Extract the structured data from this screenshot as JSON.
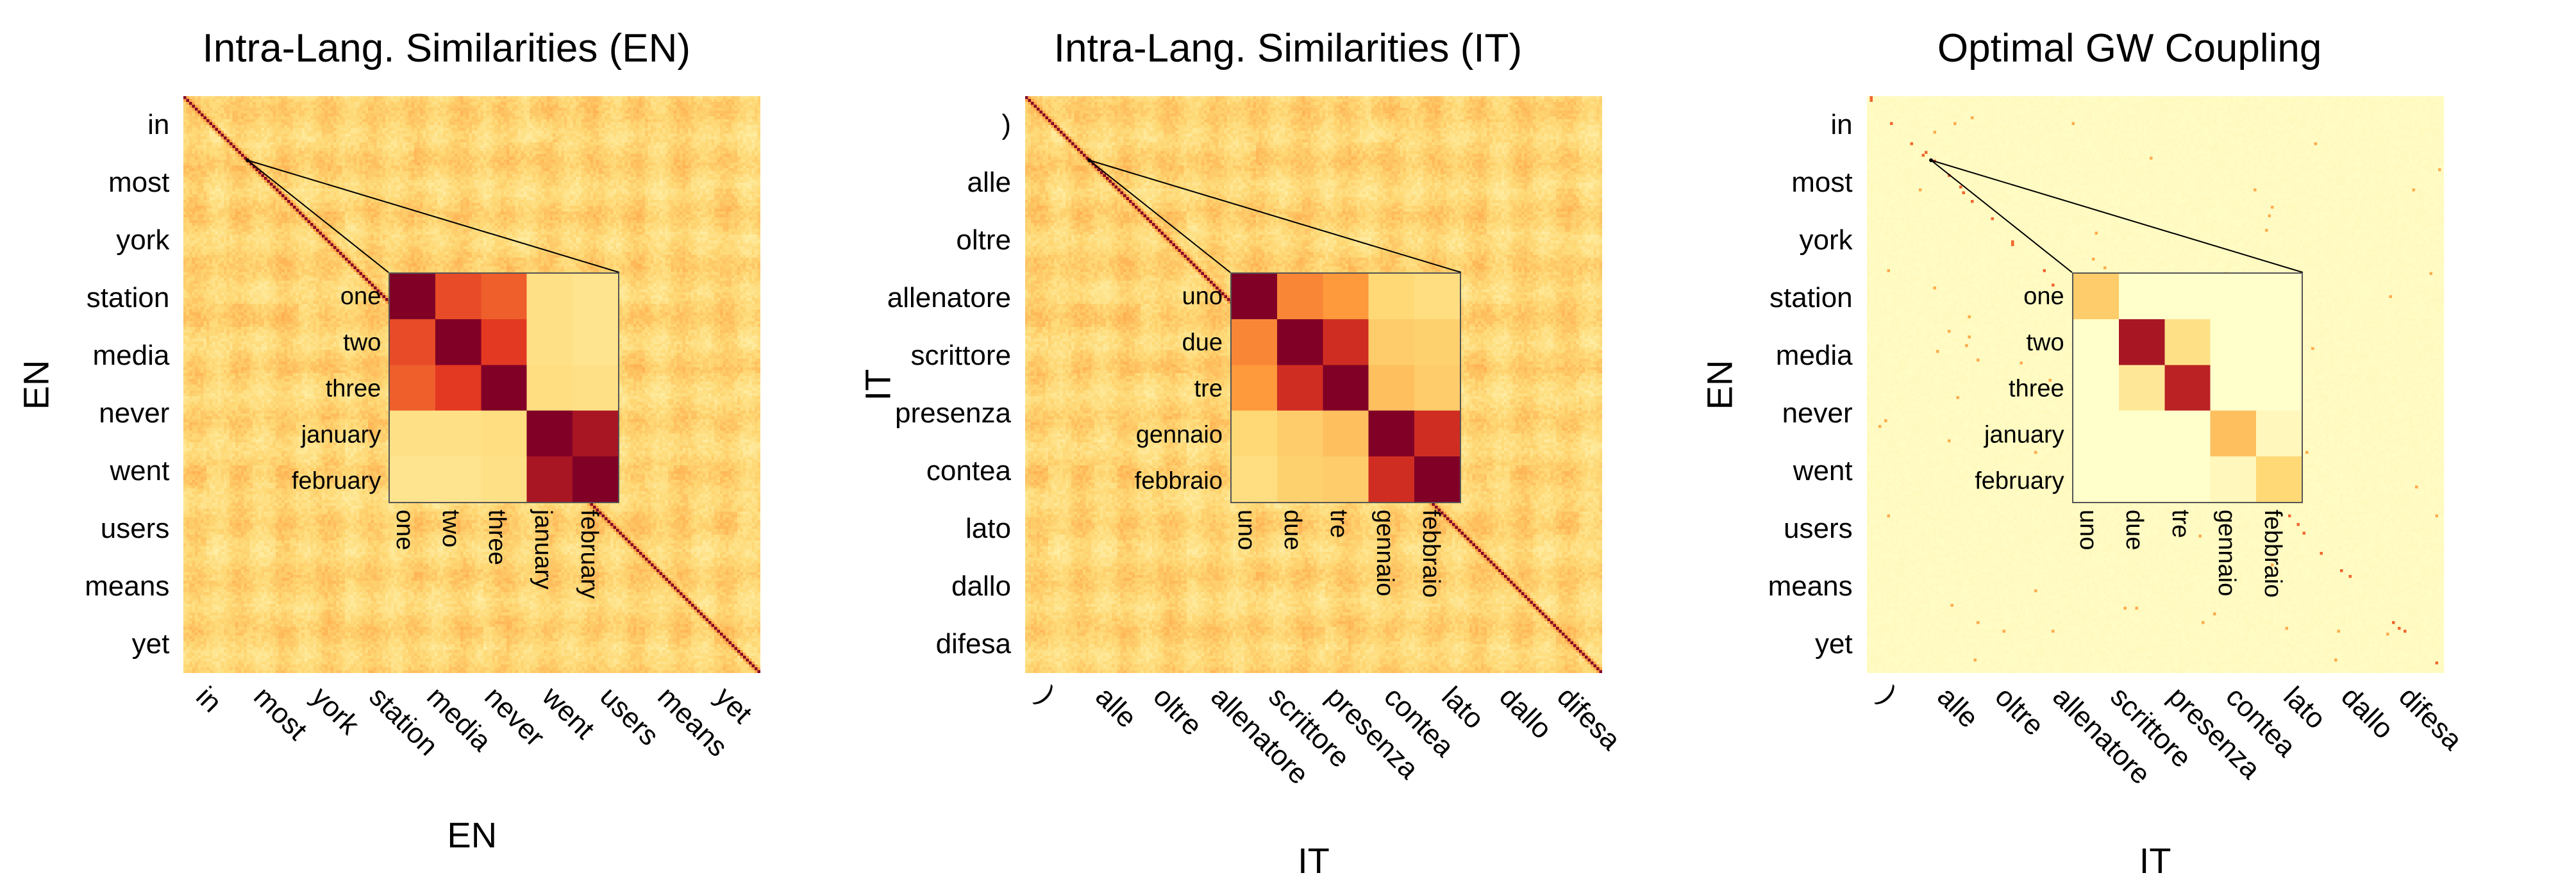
{
  "chart_data": [
    {
      "id": "en",
      "type": "heatmap",
      "title": "Intra-Lang. Similarities (EN)",
      "xlabel": "EN",
      "ylabel": "EN",
      "x_ticks": [
        "in",
        "most",
        "york",
        "station",
        "media",
        "never",
        "went",
        "users",
        "means",
        "yet"
      ],
      "y_ticks": [
        "in",
        "most",
        "york",
        "station",
        "media",
        "never",
        "went",
        "users",
        "means",
        "yet"
      ],
      "xlim": [
        0,
        1000
      ],
      "ylim": [
        0,
        1000
      ],
      "note": "1000x1000 cosine-similarity matrix; mostly low (pale yellow), diagonal high (dark red).",
      "inset": {
        "type": "heatmap",
        "row_labels": [
          "one",
          "two",
          "three",
          "january",
          "february"
        ],
        "col_labels": [
          "one",
          "two",
          "three",
          "january",
          "february"
        ],
        "values": [
          [
            1.0,
            0.7,
            0.65,
            0.2,
            0.18
          ],
          [
            0.7,
            1.0,
            0.75,
            0.2,
            0.18
          ],
          [
            0.65,
            0.75,
            1.0,
            0.22,
            0.2
          ],
          [
            0.2,
            0.2,
            0.22,
            1.0,
            0.9
          ],
          [
            0.18,
            0.18,
            0.2,
            0.9,
            1.0
          ]
        ],
        "colorscale": "YlOrRd",
        "vmin": 0.0,
        "vmax": 1.0
      }
    },
    {
      "id": "it",
      "type": "heatmap",
      "title": "Intra-Lang. Similarities (IT)",
      "xlabel": "IT",
      "ylabel": "IT",
      "x_ticks": [
        ")",
        "alle",
        "oltre",
        "allenatore",
        "scrittore",
        "presenza",
        "contea",
        "lato",
        "dallo",
        "difesa"
      ],
      "y_ticks": [
        ")",
        "alle",
        "oltre",
        "allenatore",
        "scrittore",
        "presenza",
        "contea",
        "lato",
        "dallo",
        "difesa"
      ],
      "xlim": [
        0,
        1000
      ],
      "ylim": [
        0,
        1000
      ],
      "note": "1000x1000 cosine-similarity matrix; mostly low (pale yellow), diagonal high (dark red).",
      "inset": {
        "type": "heatmap",
        "row_labels": [
          "uno",
          "due",
          "tre",
          "gennaio",
          "febbraio"
        ],
        "col_labels": [
          "uno",
          "due",
          "tre",
          "gennaio",
          "febbraio"
        ],
        "values": [
          [
            1.0,
            0.55,
            0.5,
            0.25,
            0.22
          ],
          [
            0.55,
            1.0,
            0.8,
            0.3,
            0.28
          ],
          [
            0.5,
            0.8,
            1.0,
            0.35,
            0.3
          ],
          [
            0.25,
            0.3,
            0.35,
            1.0,
            0.8
          ],
          [
            0.22,
            0.28,
            0.3,
            0.8,
            1.0
          ]
        ],
        "colorscale": "YlOrRd",
        "vmin": 0.0,
        "vmax": 1.0
      }
    },
    {
      "id": "gw",
      "type": "heatmap",
      "title": "Optimal GW Coupling",
      "xlabel": "IT",
      "ylabel": "EN",
      "x_ticks": [
        ")",
        "alle",
        "oltre",
        "allenatore",
        "scrittore",
        "presenza",
        "contea",
        "lato",
        "dallo",
        "difesa"
      ],
      "y_ticks": [
        "in",
        "most",
        "york",
        "station",
        "media",
        "never",
        "went",
        "users",
        "means",
        "yet"
      ],
      "xlim": [
        0,
        1000
      ],
      "ylim": [
        0,
        1000
      ],
      "note": "Sparse coupling matrix; near-zero everywhere (very pale), tiny dark points near diagonal.",
      "inset": {
        "type": "heatmap",
        "row_labels": [
          "one",
          "two",
          "three",
          "january",
          "february"
        ],
        "col_labels": [
          "uno",
          "due",
          "tre",
          "gennaio",
          "febbraio"
        ],
        "values": [
          [
            0.3,
            0.0,
            0.0,
            0.0,
            0.0
          ],
          [
            0.0,
            0.9,
            0.2,
            0.0,
            0.0
          ],
          [
            0.0,
            0.15,
            0.85,
            0.0,
            0.0
          ],
          [
            0.0,
            0.0,
            0.0,
            0.35,
            0.05
          ],
          [
            0.0,
            0.0,
            0.0,
            0.05,
            0.25
          ]
        ],
        "colorscale": "YlOrRd",
        "vmin": 0.0,
        "vmax": 1.0
      }
    }
  ],
  "colors": {
    "bg": "#ffffff",
    "stroke": "#000000"
  }
}
